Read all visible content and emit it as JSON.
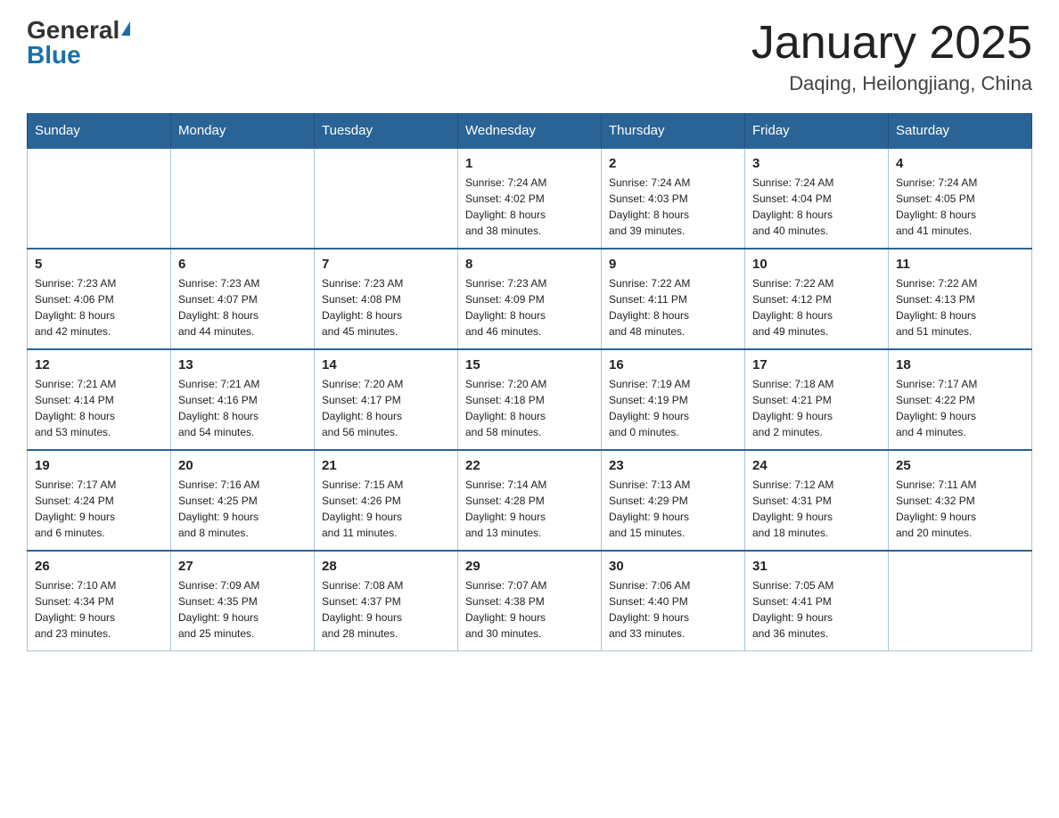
{
  "header": {
    "logo_general": "General",
    "logo_blue": "Blue",
    "month_title": "January 2025",
    "location": "Daqing, Heilongjiang, China"
  },
  "weekdays": [
    "Sunday",
    "Monday",
    "Tuesday",
    "Wednesday",
    "Thursday",
    "Friday",
    "Saturday"
  ],
  "weeks": [
    [
      {
        "day": "",
        "info": ""
      },
      {
        "day": "",
        "info": ""
      },
      {
        "day": "",
        "info": ""
      },
      {
        "day": "1",
        "info": "Sunrise: 7:24 AM\nSunset: 4:02 PM\nDaylight: 8 hours\nand 38 minutes."
      },
      {
        "day": "2",
        "info": "Sunrise: 7:24 AM\nSunset: 4:03 PM\nDaylight: 8 hours\nand 39 minutes."
      },
      {
        "day": "3",
        "info": "Sunrise: 7:24 AM\nSunset: 4:04 PM\nDaylight: 8 hours\nand 40 minutes."
      },
      {
        "day": "4",
        "info": "Sunrise: 7:24 AM\nSunset: 4:05 PM\nDaylight: 8 hours\nand 41 minutes."
      }
    ],
    [
      {
        "day": "5",
        "info": "Sunrise: 7:23 AM\nSunset: 4:06 PM\nDaylight: 8 hours\nand 42 minutes."
      },
      {
        "day": "6",
        "info": "Sunrise: 7:23 AM\nSunset: 4:07 PM\nDaylight: 8 hours\nand 44 minutes."
      },
      {
        "day": "7",
        "info": "Sunrise: 7:23 AM\nSunset: 4:08 PM\nDaylight: 8 hours\nand 45 minutes."
      },
      {
        "day": "8",
        "info": "Sunrise: 7:23 AM\nSunset: 4:09 PM\nDaylight: 8 hours\nand 46 minutes."
      },
      {
        "day": "9",
        "info": "Sunrise: 7:22 AM\nSunset: 4:11 PM\nDaylight: 8 hours\nand 48 minutes."
      },
      {
        "day": "10",
        "info": "Sunrise: 7:22 AM\nSunset: 4:12 PM\nDaylight: 8 hours\nand 49 minutes."
      },
      {
        "day": "11",
        "info": "Sunrise: 7:22 AM\nSunset: 4:13 PM\nDaylight: 8 hours\nand 51 minutes."
      }
    ],
    [
      {
        "day": "12",
        "info": "Sunrise: 7:21 AM\nSunset: 4:14 PM\nDaylight: 8 hours\nand 53 minutes."
      },
      {
        "day": "13",
        "info": "Sunrise: 7:21 AM\nSunset: 4:16 PM\nDaylight: 8 hours\nand 54 minutes."
      },
      {
        "day": "14",
        "info": "Sunrise: 7:20 AM\nSunset: 4:17 PM\nDaylight: 8 hours\nand 56 minutes."
      },
      {
        "day": "15",
        "info": "Sunrise: 7:20 AM\nSunset: 4:18 PM\nDaylight: 8 hours\nand 58 minutes."
      },
      {
        "day": "16",
        "info": "Sunrise: 7:19 AM\nSunset: 4:19 PM\nDaylight: 9 hours\nand 0 minutes."
      },
      {
        "day": "17",
        "info": "Sunrise: 7:18 AM\nSunset: 4:21 PM\nDaylight: 9 hours\nand 2 minutes."
      },
      {
        "day": "18",
        "info": "Sunrise: 7:17 AM\nSunset: 4:22 PM\nDaylight: 9 hours\nand 4 minutes."
      }
    ],
    [
      {
        "day": "19",
        "info": "Sunrise: 7:17 AM\nSunset: 4:24 PM\nDaylight: 9 hours\nand 6 minutes."
      },
      {
        "day": "20",
        "info": "Sunrise: 7:16 AM\nSunset: 4:25 PM\nDaylight: 9 hours\nand 8 minutes."
      },
      {
        "day": "21",
        "info": "Sunrise: 7:15 AM\nSunset: 4:26 PM\nDaylight: 9 hours\nand 11 minutes."
      },
      {
        "day": "22",
        "info": "Sunrise: 7:14 AM\nSunset: 4:28 PM\nDaylight: 9 hours\nand 13 minutes."
      },
      {
        "day": "23",
        "info": "Sunrise: 7:13 AM\nSunset: 4:29 PM\nDaylight: 9 hours\nand 15 minutes."
      },
      {
        "day": "24",
        "info": "Sunrise: 7:12 AM\nSunset: 4:31 PM\nDaylight: 9 hours\nand 18 minutes."
      },
      {
        "day": "25",
        "info": "Sunrise: 7:11 AM\nSunset: 4:32 PM\nDaylight: 9 hours\nand 20 minutes."
      }
    ],
    [
      {
        "day": "26",
        "info": "Sunrise: 7:10 AM\nSunset: 4:34 PM\nDaylight: 9 hours\nand 23 minutes."
      },
      {
        "day": "27",
        "info": "Sunrise: 7:09 AM\nSunset: 4:35 PM\nDaylight: 9 hours\nand 25 minutes."
      },
      {
        "day": "28",
        "info": "Sunrise: 7:08 AM\nSunset: 4:37 PM\nDaylight: 9 hours\nand 28 minutes."
      },
      {
        "day": "29",
        "info": "Sunrise: 7:07 AM\nSunset: 4:38 PM\nDaylight: 9 hours\nand 30 minutes."
      },
      {
        "day": "30",
        "info": "Sunrise: 7:06 AM\nSunset: 4:40 PM\nDaylight: 9 hours\nand 33 minutes."
      },
      {
        "day": "31",
        "info": "Sunrise: 7:05 AM\nSunset: 4:41 PM\nDaylight: 9 hours\nand 36 minutes."
      },
      {
        "day": "",
        "info": ""
      }
    ]
  ]
}
